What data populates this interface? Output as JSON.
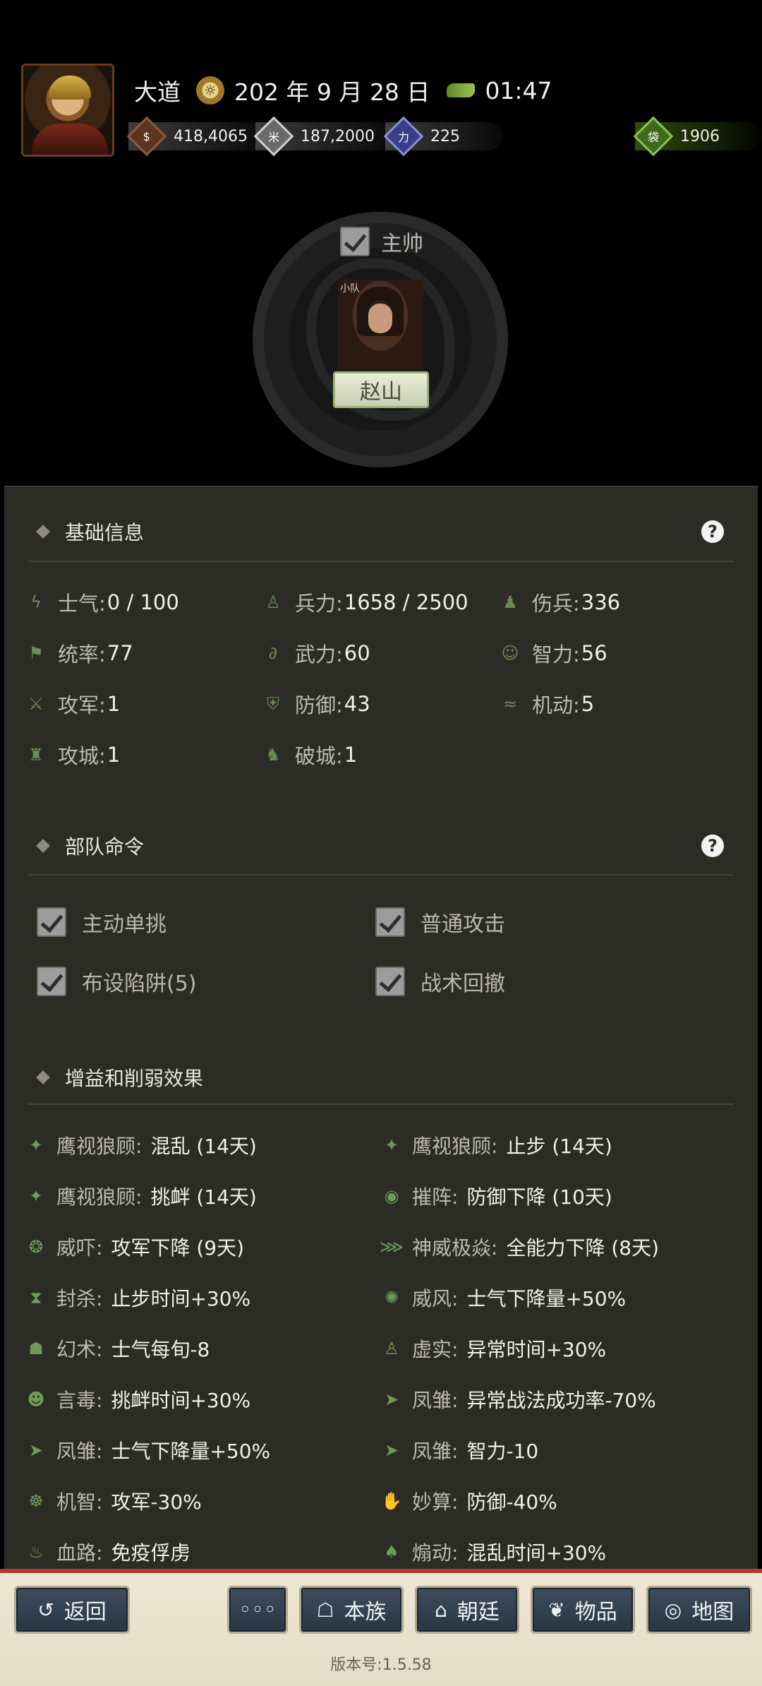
{
  "header": {
    "place": "大道",
    "date": "202 年 9 月 28 日",
    "time": "01:47",
    "resources": [
      {
        "name": "copper-coins",
        "value": "418,4065",
        "icon_label": "$"
      },
      {
        "name": "grain",
        "value": "187,2000",
        "icon_label": "米"
      },
      {
        "name": "strength",
        "value": "225",
        "icon_label": "力"
      }
    ],
    "extra_resource": {
      "name": "supply-bag",
      "value": "1906",
      "icon_label": "袋"
    }
  },
  "commander": {
    "checkbox_label": "主帅",
    "unit_tag": "小队",
    "unit_name": "赵山"
  },
  "basic_info": {
    "title": "基础信息",
    "stats": [
      {
        "label": "士气:",
        "value": "0 / 100",
        "icon": "flame-icon"
      },
      {
        "label": "兵力:",
        "value": "1658 / 2500",
        "icon": "soldier-icon"
      },
      {
        "label": "伤兵:",
        "value": "336",
        "icon": "wounded-icon"
      },
      {
        "label": "统率:",
        "value": "77",
        "icon": "flag-icon"
      },
      {
        "label": "武力:",
        "value": "60",
        "icon": "arm-icon"
      },
      {
        "label": "智力:",
        "value": "56",
        "icon": "brain-icon"
      },
      {
        "label": "攻军:",
        "value": "1",
        "icon": "crossed-swords-icon"
      },
      {
        "label": "防御:",
        "value": "43",
        "icon": "shield-icon"
      },
      {
        "label": "机动:",
        "value": "5",
        "icon": "speed-icon"
      },
      {
        "label": "攻城:",
        "value": "1",
        "icon": "tower-icon"
      },
      {
        "label": "破城:",
        "value": "1",
        "icon": "horse-icon"
      }
    ]
  },
  "orders": {
    "title": "部队命令",
    "items": [
      {
        "label": "主动单挑",
        "checked": true
      },
      {
        "label": "普通攻击",
        "checked": true
      },
      {
        "label": "布设陷阱(5)",
        "checked": true
      },
      {
        "label": "战术回撤",
        "checked": true
      }
    ]
  },
  "effects": {
    "title": "增益和削弱效果",
    "items": [
      {
        "source": "鹰视狼顾:",
        "effect": "混乱 (14天)",
        "icon": "eagle-icon"
      },
      {
        "source": "鹰视狼顾:",
        "effect": "止步 (14天)",
        "icon": "eagle-icon"
      },
      {
        "source": "鹰视狼顾:",
        "effect": "挑衅 (14天)",
        "icon": "eagle-icon"
      },
      {
        "source": "摧阵:",
        "effect": "防御下降 (10天)",
        "icon": "eye-icon"
      },
      {
        "source": "威吓:",
        "effect": "攻军下降 (9天)",
        "icon": "flame-icon"
      },
      {
        "source": "神威极焱:",
        "effect": "全能力下降 (8天)",
        "icon": "claw-icon"
      },
      {
        "source": "封杀:",
        "effect": "止步时间+30%",
        "icon": "hourglass-icon"
      },
      {
        "source": "威风:",
        "effect": "士气下降量+50%",
        "icon": "burst-icon"
      },
      {
        "source": "幻术:",
        "effect": "士气每旬-8",
        "icon": "mask-icon"
      },
      {
        "source": "虚实:",
        "effect": "异常时间+30%",
        "icon": "figure-icon"
      },
      {
        "source": "言毒:",
        "effect": "挑衅时间+30%",
        "icon": "mouth-icon"
      },
      {
        "source": "凤雏:",
        "effect": "异常战法成功率-70%",
        "icon": "bird-icon"
      },
      {
        "source": "凤雏:",
        "effect": "士气下降量+50%",
        "icon": "bird-icon"
      },
      {
        "source": "凤雏:",
        "effect": "智力-10",
        "icon": "bird-icon"
      },
      {
        "source": "机智:",
        "effect": "攻军-30%",
        "icon": "head-icon"
      },
      {
        "source": "妙算:",
        "effect": "防御-40%",
        "icon": "hand-icon"
      },
      {
        "source": "血路:",
        "effect": "免疫俘虏",
        "icon": "blood-icon"
      },
      {
        "source": "煽动:",
        "effect": "混乱时间+30%",
        "icon": "crowd-icon"
      }
    ]
  },
  "bottom_nav": {
    "back": "返回",
    "more": "◦◦◦",
    "clan": "本族",
    "court": "朝廷",
    "items": "物品",
    "map": "地图",
    "version": "版本号:1.5.58"
  }
}
